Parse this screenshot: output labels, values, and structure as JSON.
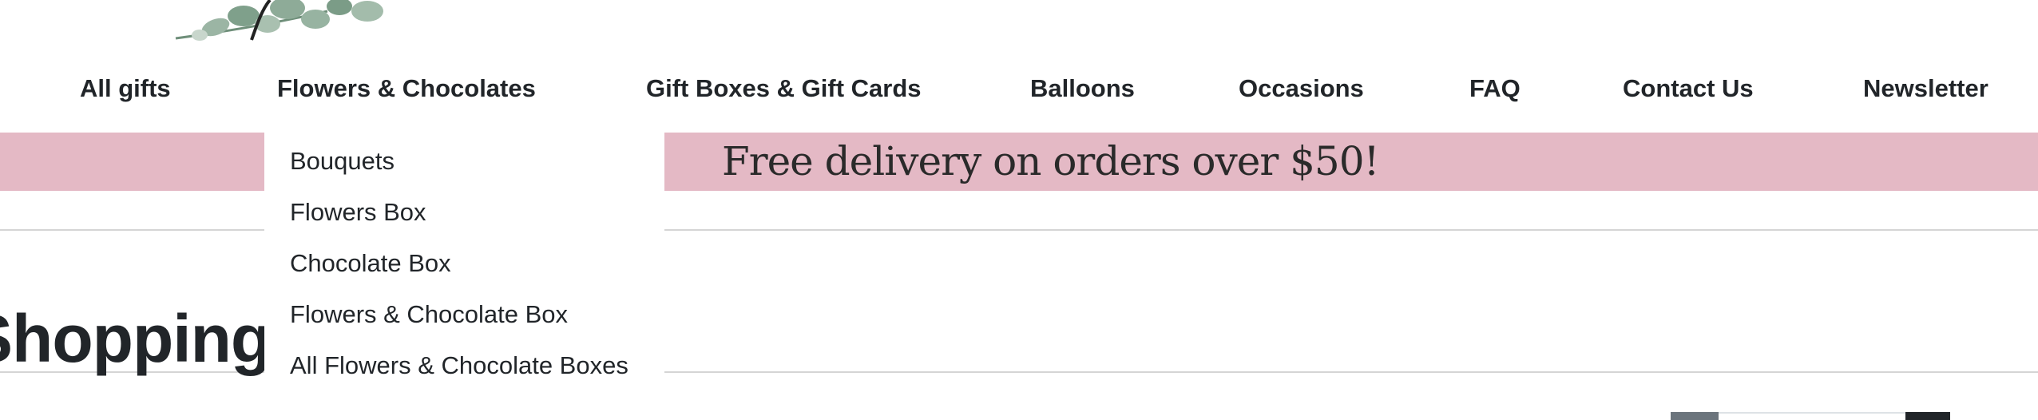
{
  "nav": {
    "items": [
      {
        "label": "All gifts"
      },
      {
        "label": "Flowers & Chocolates"
      },
      {
        "label": "Gift Boxes & Gift Cards"
      },
      {
        "label": "Balloons"
      },
      {
        "label": "Occasions"
      },
      {
        "label": "FAQ"
      },
      {
        "label": "Contact Us"
      },
      {
        "label": "Newsletter"
      }
    ]
  },
  "dropdown": {
    "items": [
      {
        "label": "Bouquets"
      },
      {
        "label": "Flowers Box"
      },
      {
        "label": "Chocolate Box"
      },
      {
        "label": "Flowers & Chocolate Box"
      },
      {
        "label": "All Flowers & Chocolate Boxes"
      }
    ]
  },
  "banner": {
    "text": "Free delivery on orders over $50!"
  },
  "page": {
    "title": "Shopping Bag"
  },
  "colors": {
    "banner_bg": "#e4b9c5",
    "text": "#212529"
  }
}
